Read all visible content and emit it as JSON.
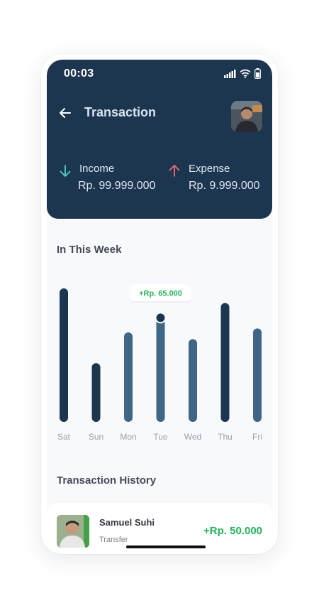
{
  "status": {
    "time": "00:03"
  },
  "header": {
    "title": "Transaction"
  },
  "summary": {
    "income": {
      "label": "Income",
      "amount": "Rp. 99.999.000",
      "color": "#4fd1c5"
    },
    "expense": {
      "label": "Expense",
      "amount": "Rp. 9.999.000",
      "color": "#ef6a74"
    }
  },
  "week": {
    "title": "In This Week"
  },
  "chart_data": {
    "type": "bar",
    "categories": [
      "Sat",
      "Sun",
      "Mon",
      "Tue",
      "Wed",
      "Thu",
      "Fri"
    ],
    "values": [
      100,
      44,
      67,
      78,
      62,
      89,
      70
    ],
    "ylim": [
      0,
      100
    ],
    "highlighted": "Tue",
    "tooltip": "+Rp. 65.000",
    "colors": {
      "dark": "#1d3650",
      "light": "#3f6785"
    },
    "dark_bars": [
      "Sat",
      "Sun",
      "Thu"
    ]
  },
  "history": {
    "title": "Transaction History",
    "items": [
      {
        "name": "Samuel Suhi",
        "type": "Transfer",
        "amount": "+Rp. 50.000"
      }
    ]
  }
}
